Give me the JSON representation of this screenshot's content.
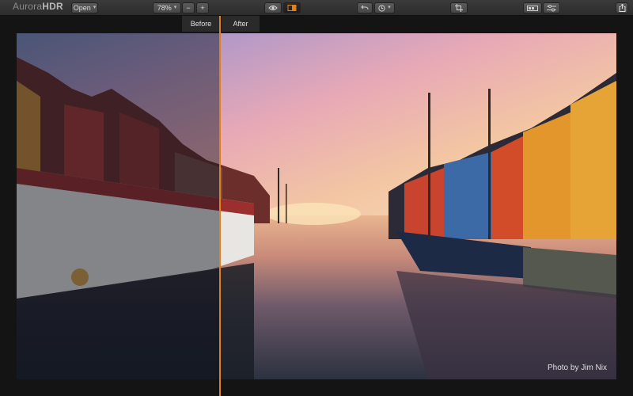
{
  "app": {
    "title_prefix": "Aurora",
    "title_suffix": "HDR"
  },
  "toolbar": {
    "open_label": "Open",
    "zoom_value": "78%",
    "zoom_out_label": "−",
    "zoom_in_label": "+"
  },
  "compare": {
    "before_label": "Before",
    "after_label": "After"
  },
  "photo": {
    "caption": "Photo by Jim Nix"
  },
  "colors": {
    "split_accent": "#e07f1f",
    "toolbar_bg": "#333333",
    "workspace_bg": "#141414"
  },
  "icons": [
    "eye-icon",
    "split-view-icon",
    "undo-icon",
    "history-icon",
    "crop-icon",
    "layers-icon",
    "adjustments-icon",
    "share-icon"
  ]
}
